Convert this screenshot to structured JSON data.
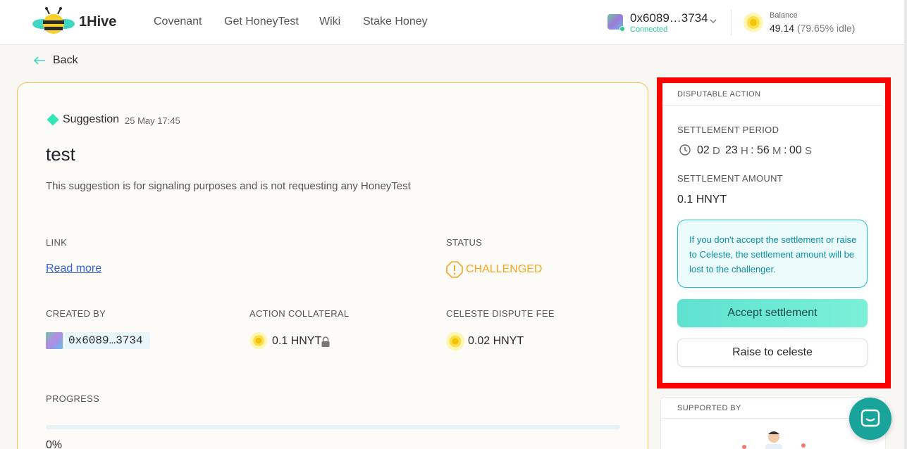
{
  "header": {
    "brand": "1Hive",
    "nav": [
      "Covenant",
      "Get HoneyTest",
      "Wiki",
      "Stake Honey"
    ],
    "account": {
      "address": "0x6089…3734",
      "status": "Connected"
    },
    "balance": {
      "label": "Balance",
      "value": "49.14",
      "idle": "(79.65% idle)"
    }
  },
  "back_label": "Back",
  "proposal": {
    "type": "Suggestion",
    "date": "25 May 17:45",
    "title": "test",
    "description": "This suggestion is for signaling purposes and is not requesting any HoneyTest",
    "link_label": "LINK",
    "link_text": "Read more",
    "status_label": "STATUS",
    "status": "CHALLENGED",
    "created_by_label": "CREATED BY",
    "created_by": "0x6089…3734",
    "collateral_label": "ACTION COLLATERAL",
    "collateral": "0.1 HNYT",
    "dispute_fee_label": "CELESTE DISPUTE FEE",
    "dispute_fee": "0.02 HNYT",
    "progress_label": "PROGRESS",
    "progress_text": "0%",
    "progress": 0
  },
  "disputable": {
    "header": "DISPUTABLE ACTION",
    "settlement_period_label": "SETTLEMENT PERIOD",
    "timer": {
      "d": "02",
      "d_unit": "D",
      "h": "23",
      "h_unit": "H",
      "m": "56",
      "m_unit": "M",
      "s": "00",
      "s_unit": "S"
    },
    "settlement_amount_label": "SETTLEMENT AMOUNT",
    "settlement_amount": "0.1 HNYT",
    "info": "If you don't accept the settlement or raise to Celeste, the settlement amount will be lost to the challenger.",
    "accept_label": "Accept settlement",
    "raise_label": "Raise to celeste"
  },
  "supported_by_label": "SUPPORTED BY",
  "icons": [
    "bee-logo-icon",
    "chevron-down-icon",
    "honey-coin-icon",
    "arrow-left-icon",
    "diamond-icon",
    "warning-icon",
    "lock-icon",
    "clock-icon",
    "chat-icon"
  ],
  "colors": {
    "accent": "#3bd6c2",
    "challenged": "#f5a623",
    "card_border": "#f3c25a",
    "info": "#0a8fa3",
    "highlight": "#ff0000"
  }
}
